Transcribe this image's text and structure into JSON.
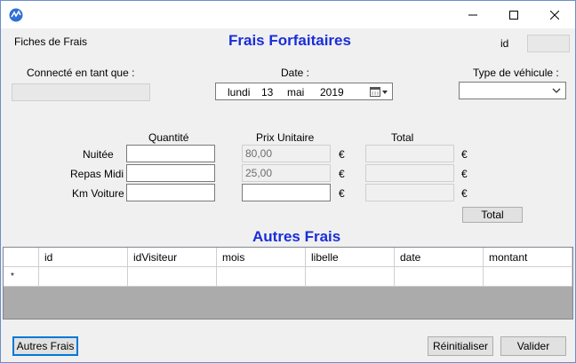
{
  "window": {
    "app_icon": "app-logo-icon",
    "buttons": {
      "minimize": "minimize-icon",
      "maximize": "maximize-icon",
      "close": "close-icon"
    }
  },
  "header": {
    "section_label": "Fiches de Frais",
    "title": "Frais Forfaitaires",
    "id_label": "id",
    "id_value": ""
  },
  "connection": {
    "label": "Connecté en tant que :",
    "value": ""
  },
  "date": {
    "label": "Date :",
    "day_name": "lundi",
    "day": "13",
    "month": "mai",
    "year": "2019",
    "icon": "calendar-dropdown-icon"
  },
  "vehicle": {
    "label": "Type de véhicule :",
    "selected": "",
    "icon": "chevron-down-icon"
  },
  "forfait": {
    "headers": {
      "quantity": "Quantité",
      "unit_price": "Prix Unitaire",
      "total": "Total"
    },
    "currency": "€",
    "rows": [
      {
        "label": "Nuitée",
        "quantity": "",
        "unit_price": "80,00",
        "total": ""
      },
      {
        "label": "Repas Midi",
        "quantity": "",
        "unit_price": "25,00",
        "total": ""
      },
      {
        "label": "Km Voiture",
        "quantity": "",
        "unit_price": "",
        "total": ""
      }
    ],
    "total_button": "Total"
  },
  "autres_frais": {
    "title": "Autres Frais",
    "columns": [
      "id",
      "idVisiteur",
      "mois",
      "libelle",
      "date",
      "montant"
    ],
    "new_row_marker": "*"
  },
  "footer": {
    "autres_frais_button": "Autres Frais",
    "reset_button": "Réinitialiser",
    "validate_button": "Valider"
  },
  "colors": {
    "accent_blue": "#1a2ed8",
    "window_bg": "#f0f0f0",
    "grid_bg": "#ababab"
  }
}
